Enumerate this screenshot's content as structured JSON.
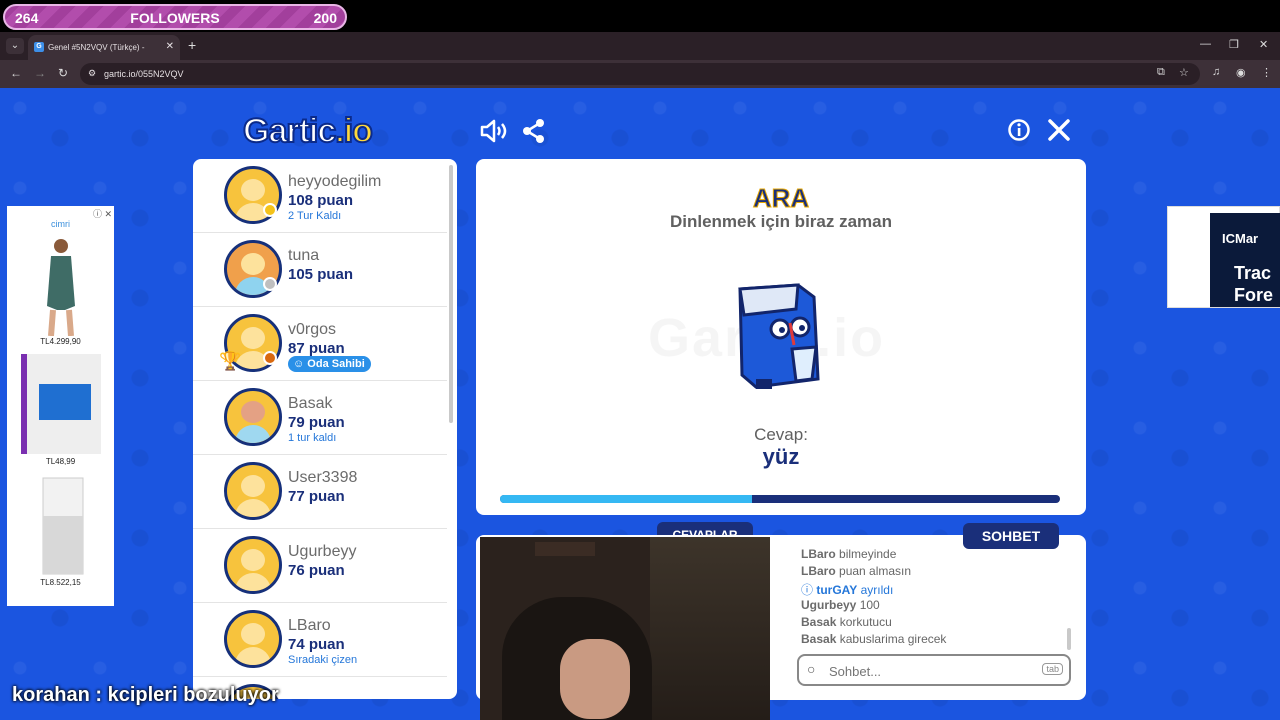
{
  "overlay": {
    "followers_left": "264",
    "followers_label": "FOLLOWERS",
    "followers_right": "200"
  },
  "browser": {
    "tab_title": "Genel #5N2VQV (Türkçe) - ",
    "url": "gartic.io/055N2VQV"
  },
  "header": {
    "logo_main": "Gartic",
    "logo_suffix": ".io"
  },
  "players": [
    {
      "name": "heyyodegilim",
      "points": "108 puan",
      "note": "2 Tur Kaldı",
      "status": "#f4c21a"
    },
    {
      "name": "tuna",
      "points": "105 puan",
      "note": "",
      "status": "#bfbfbf"
    },
    {
      "name": "v0rgos",
      "points": "87 puan",
      "badge": "Oda Sahibi",
      "status": "#d9690e"
    },
    {
      "name": "Basak",
      "points": "79 puan",
      "note": "1 tur kaldı"
    },
    {
      "name": "User3398",
      "points": "77 puan",
      "note": ""
    },
    {
      "name": "Ugurbeyy",
      "points": "76 puan",
      "note": ""
    },
    {
      "name": "LBaro",
      "points": "74 puan",
      "note": "Sıradaki çizen"
    }
  ],
  "main": {
    "title": "ARA",
    "subtitle": "Dinlenmek için biraz zaman",
    "answer_label": "Cevap:",
    "answer": "yüz",
    "progress": 0.45
  },
  "tabs": {
    "answers": "CEVAPLAR",
    "chat": "SOHBET"
  },
  "chat": {
    "messages": [
      {
        "name": "LBaro",
        "text": "bilmeyinde"
      },
      {
        "name": "LBaro",
        "text": "puan almasın"
      },
      {
        "name": "turGAY",
        "text": "ayrıldı",
        "info": true
      },
      {
        "name": "Ugurbeyy",
        "text": "100"
      },
      {
        "name": "Basak",
        "text": "korkutucu"
      },
      {
        "name": "Basak",
        "text": "kabuslarima girecek"
      }
    ],
    "placeholder": "Sohbet...",
    "tab_key": "tab"
  },
  "ads": {
    "left_brand": "cimri",
    "left_prices": [
      "TL4.299,90",
      "TL48,99",
      "TL8.522,15"
    ],
    "right_brand": "ICMar",
    "right_line1": "Trac",
    "right_line2": "Fore"
  },
  "caption": {
    "name": "korahan",
    "sep": " : ",
    "text": "kcipleri bozuluyor"
  }
}
